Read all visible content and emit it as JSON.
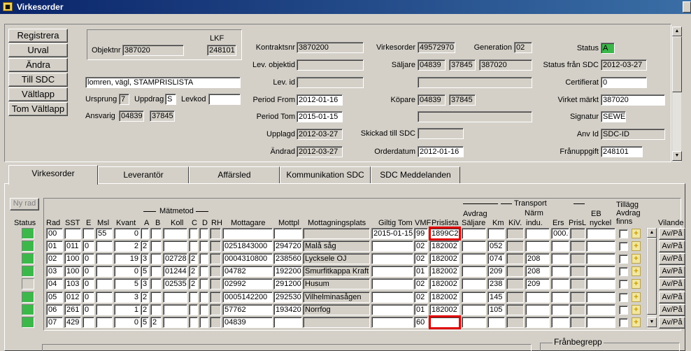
{
  "window": {
    "title": "Virkesorder"
  },
  "side_buttons": [
    "Registrera",
    "Urval",
    "Ändra",
    "Till SDC",
    "Vältlapp",
    "Tom Vältlapp"
  ],
  "header": {
    "objektnr_label": "Objektnr",
    "objektnr": "387020",
    "lkf_label": "LKF",
    "lkf": "248101",
    "description": "lomren, vägl, STAMPRISLISTA",
    "ursprung_label": "Ursprung",
    "ursprung": "7",
    "uppdrag_label": "Uppdrag",
    "uppdrag": "S",
    "levkod_label": "Levkod",
    "levkod": "",
    "ansvarig_label": "Ansvarig",
    "ansvarig_1": "04839",
    "ansvarig_2": "37845",
    "kontraktsnr_label": "Kontraktsnr",
    "kontraktsnr": "3870200",
    "lev_objektid_label": "Lev. objektid",
    "lev_objektid": "",
    "lev_id_label": "Lev. id",
    "lev_id": "",
    "period_from_label": "Period From",
    "period_from": "2012-01-16",
    "period_tom_label": "Period Tom",
    "period_tom": "2015-01-15",
    "upplagd_label": "Upplagd",
    "upplagd": "2012-03-27",
    "andrad_label": "Ändrad",
    "andrad": "2012-03-27",
    "virkesorder_label": "Virkesorder",
    "virkesorder": "49572970",
    "generation_label": "Generation",
    "generation": "02",
    "saljare_label": "Säljare",
    "saljare_1": "04839",
    "saljare_2": "37845",
    "saljare_3": "387020",
    "kopare_label": "Köpare",
    "kopare_1": "04839",
    "kopare_2": "37845",
    "skickad_label": "Skickad till SDC",
    "skickad": "",
    "orderdatum_label": "Orderdatum",
    "orderdatum": "2012-01-16",
    "status_label": "Status",
    "status": "A",
    "status_sdc_label": "Status från SDC",
    "status_sdc": "2012-03-27",
    "certifierat_label": "Certifierat",
    "certifierat": "0",
    "virket_markt_label": "Virket märkt",
    "virket_markt": "387020",
    "signatur_label": "Signatur",
    "signatur": "SEWE",
    "anv_id_label": "Anv Id",
    "anv_id": "SDC-ID",
    "franuppgift_label": "Frånuppgift",
    "franuppgift": "248101"
  },
  "tabs": [
    "Virkesorder",
    "Leverantör",
    "Affärsled",
    "Kommunikation SDC",
    "SDC Meddelanden"
  ],
  "grid": {
    "ny_rad": "Ny rad",
    "headers": {
      "status": "Status",
      "rad": "Rad",
      "sst": "SST",
      "e": "E",
      "msl": "Msl",
      "kvant": "Kvant",
      "matmetod": "Mätmetod",
      "a": "A",
      "b": "B",
      "koll": "Koll",
      "c": "C",
      "d": "D",
      "rh": "RH",
      "mottagare": "Mottagare",
      "mottpl": "Mottpl",
      "mottagningsplats": "Mottagningsplats",
      "giltig_tom": "Giltig Tom",
      "vmf": "VMF",
      "prislista": "Prislista",
      "avdrag": "Avdrag",
      "avdrag_saljare": "Säljare",
      "km": "Km",
      "kv": "KiV.",
      "transport": "Transport",
      "narm_indu_1": "Närm",
      "narm_indu_2": "indu.",
      "ers": "Ers",
      "prisl": "PrisL",
      "eb_1": "EB",
      "eb_2": "nyckel",
      "tillagg_1": "Tillägg",
      "tillagg_2": "Avdrag",
      "tillagg_3": "finns",
      "vilande": "Vilande"
    },
    "action_label": "Av/På",
    "rows": [
      {
        "status": "green",
        "rad": "00",
        "sst": "",
        "e": "",
        "msl": "55",
        "kvant": "0",
        "a": "",
        "b": "",
        "koll": "",
        "c": "",
        "d": "",
        "mottagare": "",
        "mottpl": "",
        "plats": "",
        "giltig": "2015-01-15",
        "vmf": "99",
        "prislista": "1899C2",
        "km": "",
        "narm": "",
        "ers": "000.00"
      },
      {
        "status": "green",
        "rad": "01",
        "sst": "011",
        "e": "0",
        "msl": "",
        "kvant": "2",
        "a": "2",
        "b": "",
        "koll": "",
        "c": "",
        "d": "",
        "mottagare": "0251843000",
        "mottpl": "294720",
        "plats": "Malå såg",
        "giltig": "",
        "vmf": "02",
        "prislista": "182002",
        "km": "052",
        "narm": "",
        "ers": ""
      },
      {
        "status": "green",
        "rad": "02",
        "sst": "100",
        "e": "0",
        "msl": "",
        "kvant": "19",
        "a": "3",
        "b": "",
        "koll": "02728",
        "c": "2",
        "d": "",
        "mottagare": "0004310800",
        "mottpl": "238560",
        "plats": "Lycksele OJ",
        "giltig": "",
        "vmf": "02",
        "prislista": "182002",
        "km": "074",
        "narm": "208",
        "ers": ""
      },
      {
        "status": "green",
        "rad": "03",
        "sst": "100",
        "e": "0",
        "msl": "",
        "kvant": "0",
        "a": "5",
        "b": "",
        "koll": "01244",
        "c": "2",
        "d": "",
        "mottagare": "04782",
        "mottpl": "192200",
        "plats": "Smurfitkappa Kraftlin",
        "giltig": "",
        "vmf": "01",
        "prislista": "182002",
        "km": "209",
        "narm": "208",
        "ers": ""
      },
      {
        "status": "grey",
        "rad": "04",
        "sst": "103",
        "e": "0",
        "msl": "",
        "kvant": "5",
        "a": "3",
        "b": "",
        "koll": "02535",
        "c": "2",
        "d": "",
        "mottagare": "02992",
        "mottpl": "291200",
        "plats": "Husum",
        "giltig": "",
        "vmf": "02",
        "prislista": "182002",
        "km": "238",
        "narm": "209",
        "ers": ""
      },
      {
        "status": "green",
        "rad": "05",
        "sst": "012",
        "e": "0",
        "msl": "",
        "kvant": "3",
        "a": "2",
        "b": "",
        "koll": "",
        "c": "",
        "d": "",
        "mottagare": "0005142200",
        "mottpl": "292530",
        "plats": "Vilhelminasågen",
        "giltig": "",
        "vmf": "02",
        "prislista": "182002",
        "km": "145",
        "narm": "",
        "ers": ""
      },
      {
        "status": "green",
        "rad": "06",
        "sst": "261",
        "e": "0",
        "msl": "",
        "kvant": "1",
        "a": "2",
        "b": "",
        "koll": "",
        "c": "",
        "d": "",
        "mottagare": "57762",
        "mottpl": "193420",
        "plats": "Norrfog",
        "giltig": "",
        "vmf": "01",
        "prislista": "182002",
        "km": "105",
        "narm": "",
        "ers": ""
      },
      {
        "status": "green",
        "rad": "07",
        "sst": "429",
        "e": "",
        "msl": "",
        "kvant": "0",
        "a": "5",
        "b": "2",
        "koll": "",
        "c": "",
        "d": "",
        "mottagare": "04839",
        "mottpl": "",
        "plats": "",
        "giltig": "",
        "vmf": "60",
        "prislista": "",
        "km": "",
        "narm": "",
        "ers": ""
      }
    ]
  },
  "bottom": {
    "franbegrepp": "Frånbegrepp"
  },
  "icons": {
    "up": "scroll-up-icon",
    "down": "scroll-down-icon",
    "plus": "plus-icon",
    "app": "app-icon"
  },
  "colors": {
    "status_green": "#3cb84a",
    "highlight_red": "#e00000",
    "titlebar": "#0a246a"
  }
}
